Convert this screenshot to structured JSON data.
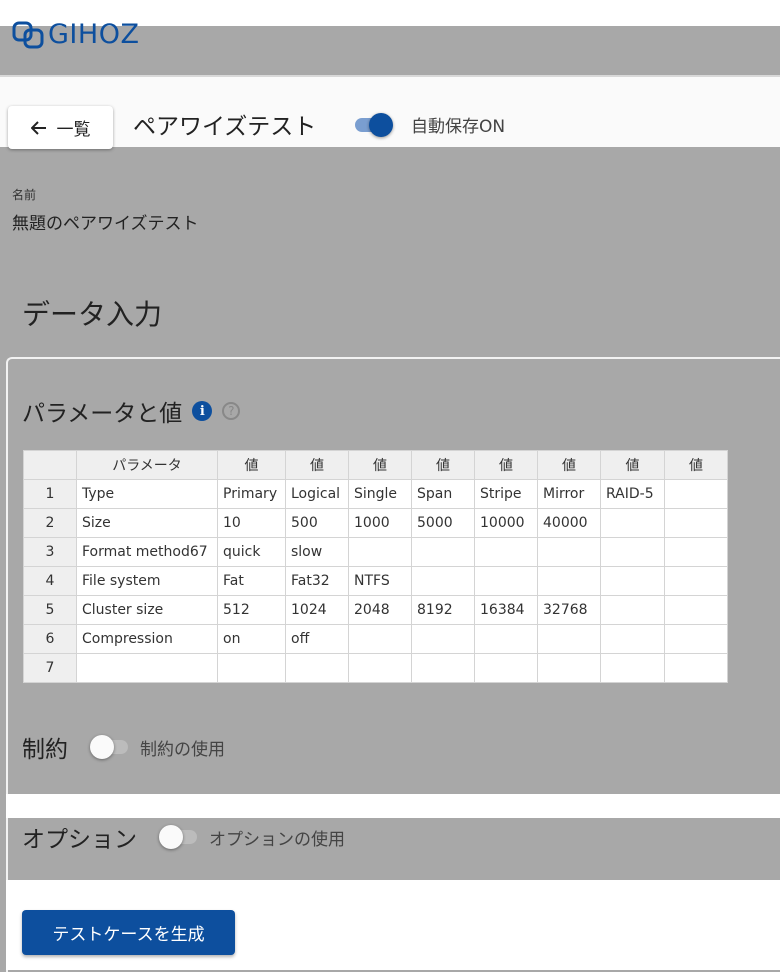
{
  "brand": {
    "name": "GIHOZ"
  },
  "toolbar": {
    "back_label": "一覧",
    "page_title": "ペアワイズテスト",
    "autosave_label": "自動保存ON"
  },
  "name_field": {
    "label": "名前",
    "value": "無題のペアワイズテスト"
  },
  "data_input": {
    "title": "データ入力"
  },
  "params": {
    "title": "パラメータと値",
    "header_param": "パラメータ",
    "header_value": "値",
    "rows": [
      {
        "num": "1",
        "name": "Type",
        "values": [
          "Primary",
          "Logical",
          "Single",
          "Span",
          "Stripe",
          "Mirror",
          "RAID-5",
          ""
        ]
      },
      {
        "num": "2",
        "name": "Size",
        "values": [
          "10",
          "500",
          "1000",
          "5000",
          "10000",
          "40000",
          "",
          ""
        ]
      },
      {
        "num": "3",
        "name": "Format method67",
        "values": [
          "quick",
          "slow",
          "",
          "",
          "",
          "",
          "",
          ""
        ]
      },
      {
        "num": "4",
        "name": "File system",
        "values": [
          "Fat",
          "Fat32",
          "NTFS",
          "",
          "",
          "",
          "",
          ""
        ]
      },
      {
        "num": "5",
        "name": "Cluster size",
        "values": [
          "512",
          "1024",
          "2048",
          "8192",
          "16384",
          "32768",
          "",
          ""
        ]
      },
      {
        "num": "6",
        "name": "Compression",
        "values": [
          "on",
          "off",
          "",
          "",
          "",
          "",
          "",
          ""
        ]
      },
      {
        "num": "7",
        "name": "",
        "values": [
          "",
          "",
          "",
          "",
          "",
          "",
          "",
          ""
        ]
      }
    ]
  },
  "constraints": {
    "title": "制約",
    "toggle_label": "制約の使用"
  },
  "options": {
    "title": "オプション",
    "toggle_label": "オプションの使用"
  },
  "generate": {
    "label": "テストケースを生成"
  },
  "colors": {
    "primary": "#0d4f9e",
    "background": "#a8a8a8"
  }
}
